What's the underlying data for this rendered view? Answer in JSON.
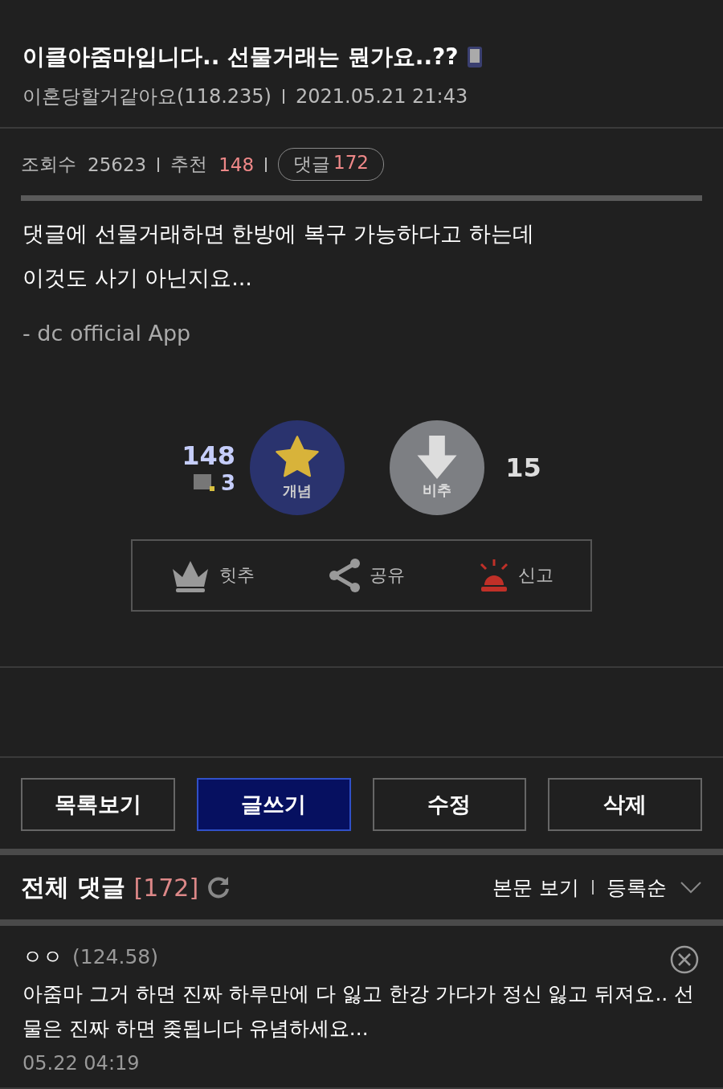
{
  "post": {
    "title": "이클아줌마입니다.. 선물거래는 뭔가요..??",
    "author": "이혼당할거같아요(118.235)",
    "date": "2021.05.21 21:43",
    "views_label": "조회수",
    "views": "25623",
    "recommend_label": "추천",
    "recommend": "148",
    "comments_label": "댓글",
    "comments": "172",
    "body": [
      "댓글에 선물거래하면 한방에 복구 가능하다고 하는데",
      "이것도 사기 아닌지요..."
    ],
    "signature": "- dc official App"
  },
  "votes": {
    "up_count": "148",
    "fixed_count": "3",
    "up_label": "개념",
    "down_label": "비추",
    "down_count": "15"
  },
  "actions": [
    {
      "kind": "crown",
      "label": "힛추"
    },
    {
      "kind": "share",
      "label": "공유"
    },
    {
      "kind": "siren",
      "label": "신고"
    }
  ],
  "buttons": [
    {
      "label": "목록보기",
      "primary": false
    },
    {
      "label": "글쓰기",
      "primary": true
    },
    {
      "label": "수정",
      "primary": false
    },
    {
      "label": "삭제",
      "primary": false
    }
  ],
  "comment_header": {
    "title": "전체 댓글",
    "count": "[172]",
    "view_body": "본문 보기",
    "sort": "등록순"
  },
  "comments": [
    {
      "name": "ㅇㅇ",
      "ip": "(124.58)",
      "text": "아줌마 그거 하면 진짜 하루만에 다 잃고 한강 가다가 정신 잃고 뒤져요.. 선물은 진짜 하면 좆됩니다 유념하세요...",
      "date": "05.22 04:19"
    }
  ]
}
